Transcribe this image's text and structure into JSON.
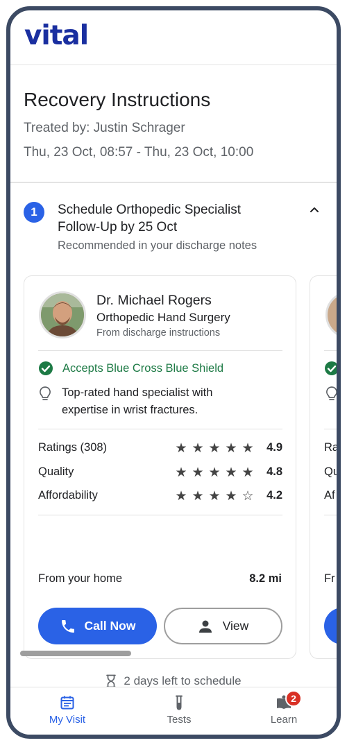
{
  "app": {
    "logo": "vital"
  },
  "visit": {
    "title": "Recovery Instructions",
    "treated_by": "Treated by: Justin Schrager",
    "time_range": "Thu, 23 Oct, 08:57 - Thu, 23 Oct, 10:00"
  },
  "step": {
    "number": "1",
    "title": "Schedule Orthopedic Specialist Follow-Up by 25 Oct",
    "subtitle": "Recommended in your discharge notes"
  },
  "doctor": {
    "name": "Dr. Michael Rogers",
    "specialty": "Orthopedic Hand Surgery",
    "source": "From discharge instructions",
    "insurance": "Accepts Blue Cross Blue Shield",
    "tip": "Top-rated hand specialist with expertise in wrist fractures.",
    "ratings": [
      {
        "label": "Ratings (308)",
        "value": "4.9",
        "stars": 5
      },
      {
        "label": "Quality",
        "value": "4.8",
        "stars": 5
      },
      {
        "label": "Affordability",
        "value": "4.2",
        "stars": 4
      }
    ],
    "distance_label": "From your home",
    "distance_value": "8.2 mi",
    "call_label": "Call Now",
    "view_label": "View"
  },
  "second_card_peek": {
    "row_labels": [
      "Ra",
      "Qu",
      "Af"
    ],
    "distance_label": "Fr"
  },
  "deadline": "2 days left to schedule",
  "nav": {
    "items": [
      {
        "label": "My Visit",
        "icon": "calendar-icon",
        "active": true
      },
      {
        "label": "Tests",
        "icon": "test-tube-icon",
        "active": false
      },
      {
        "label": "Learn",
        "icon": "book-icon",
        "active": false,
        "badge": "2"
      }
    ]
  },
  "colors": {
    "brand": "#1a2fa0",
    "accent": "#2a62e6",
    "success": "#1d7a45",
    "badge": "#d93025",
    "frame": "#3c4a63"
  }
}
